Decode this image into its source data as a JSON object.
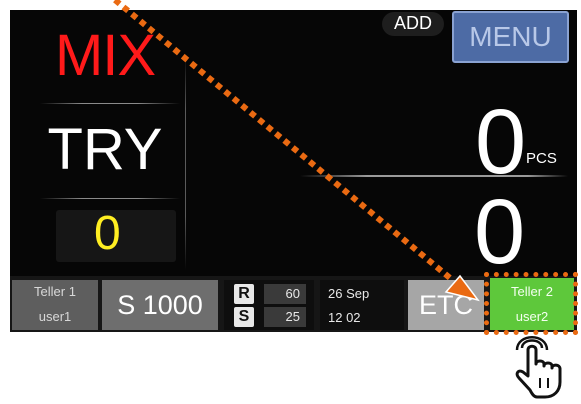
{
  "status": {
    "mode": "MIX",
    "currency": "TRY",
    "batch_count": "0"
  },
  "header": {
    "add_label": "ADD",
    "menu_label": "MENU"
  },
  "counter": {
    "pieces": "0",
    "pieces_unit": "PCS",
    "amount": "0"
  },
  "bottom_bar": {
    "teller1": {
      "line1": "Teller  1",
      "line2": "user1"
    },
    "denomination": "S 1000",
    "rs": {
      "r_key": "R",
      "r_value": "60",
      "s_key": "S",
      "s_value": "25"
    },
    "datetime": {
      "date": "26  Sep",
      "time": "12   02"
    },
    "etc_label": "ETC",
    "teller2": {
      "line1": "Teller  2",
      "line2": "user2"
    }
  },
  "colors": {
    "mode": "#ff1a1a",
    "batch": "#ffee22",
    "menu": "#4d6ba5",
    "active_teller": "#5ec83b",
    "annotation": "#ea6a12"
  },
  "icons": {
    "pointer": "hand-pointer-icon",
    "arrow": "dotted-arrow-icon"
  }
}
